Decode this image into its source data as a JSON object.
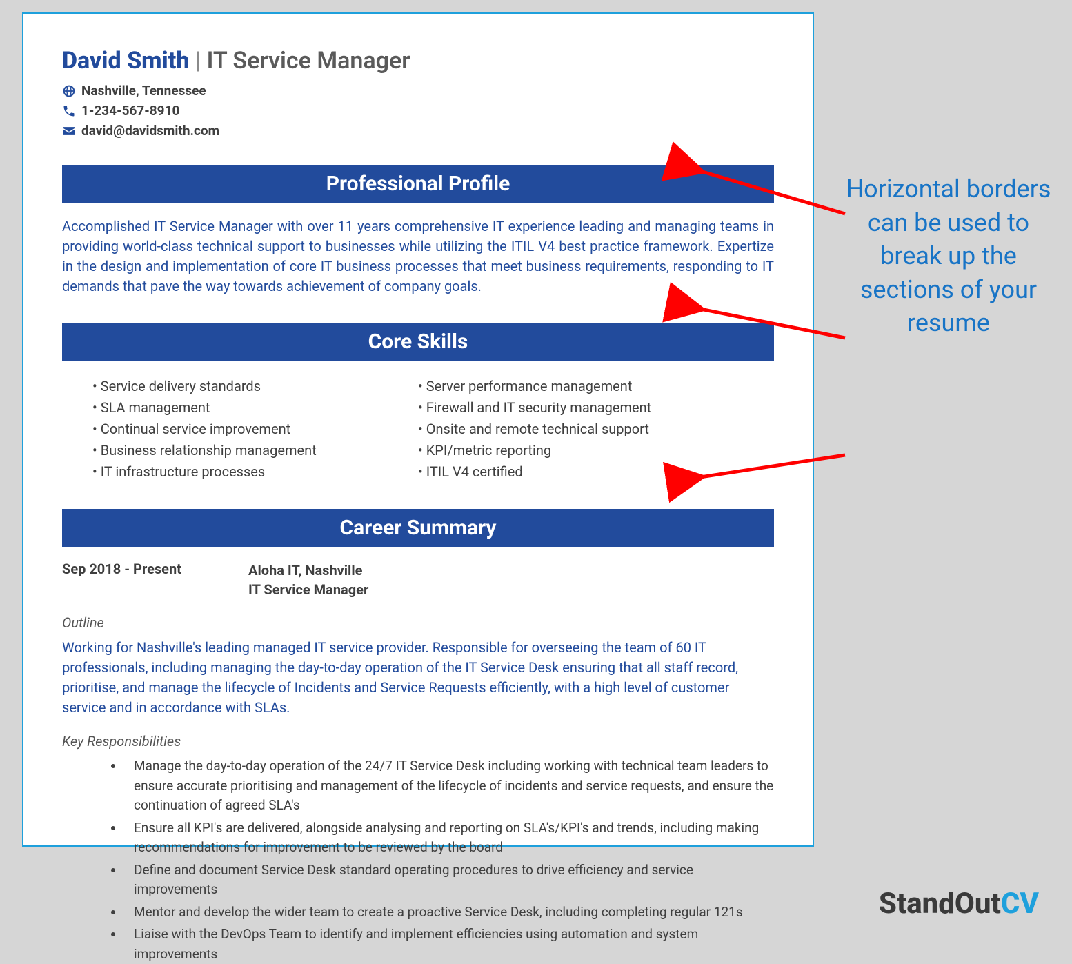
{
  "header": {
    "name": "David Smith",
    "separator": " | ",
    "title": "IT Service Manager"
  },
  "contact": {
    "location": "Nashville, Tennessee",
    "phone": "1-234-567-8910",
    "email": "david@davidsmith.com"
  },
  "sections": {
    "profile_header": "Professional Profile",
    "profile_text": "Accomplished IT Service Manager with over 11 years comprehensive IT experience leading and managing teams in providing world-class technical support to businesses while utilizing the ITIL V4 best practice framework. Expertize in the design and implementation of core IT business processes that meet business requirements, responding to IT demands that pave the way towards achievement of company goals.",
    "skills_header": "Core Skills",
    "skills_left": [
      "Service delivery standards",
      "SLA management",
      "Continual service improvement",
      "Business relationship management",
      "IT infrastructure processes"
    ],
    "skills_right": [
      "Server performance management",
      "Firewall and IT security management",
      "Onsite and remote technical support",
      "KPI/metric reporting",
      "ITIL V4 certified"
    ],
    "career_header": "Career Summary"
  },
  "career": {
    "dates": "Sep 2018 - Present",
    "employer": "Aloha IT, Nashville",
    "role": "IT Service Manager",
    "outline_label": "Outline",
    "outline_text": "Working for Nashville's leading managed IT service provider. Responsible for overseeing the team of 60 IT professionals, including managing the day-to-day operation of the IT Service Desk ensuring that all staff record, prioritise, and manage the lifecycle of Incidents and Service Requests efficiently, with a high level of customer service and in accordance with SLAs.",
    "resp_label": "Key Responsibilities",
    "responsibilities": [
      "Manage the day-to-day operation of the 24/7 IT Service Desk including working with technical team leaders to ensure accurate prioritising and management of the lifecycle of incidents and service requests, and ensure the continuation of agreed SLA's",
      "Ensure all KPI's are delivered, alongside analysing and reporting on SLA's/KPI's and trends, including making recommendations for improvement to be reviewed by the board",
      "Define and document Service Desk standard operating procedures to drive efficiency and service improvements",
      "Mentor and develop the wider team to create a proactive Service Desk, including completing regular 121s",
      "Liaise with the DevOps Team to identify and implement efficiencies using automation and system improvements"
    ]
  },
  "callout": "Horizontal borders can be used to break up the sections of your resume",
  "brand": {
    "part1": "StandOut",
    "part2": "CV"
  }
}
